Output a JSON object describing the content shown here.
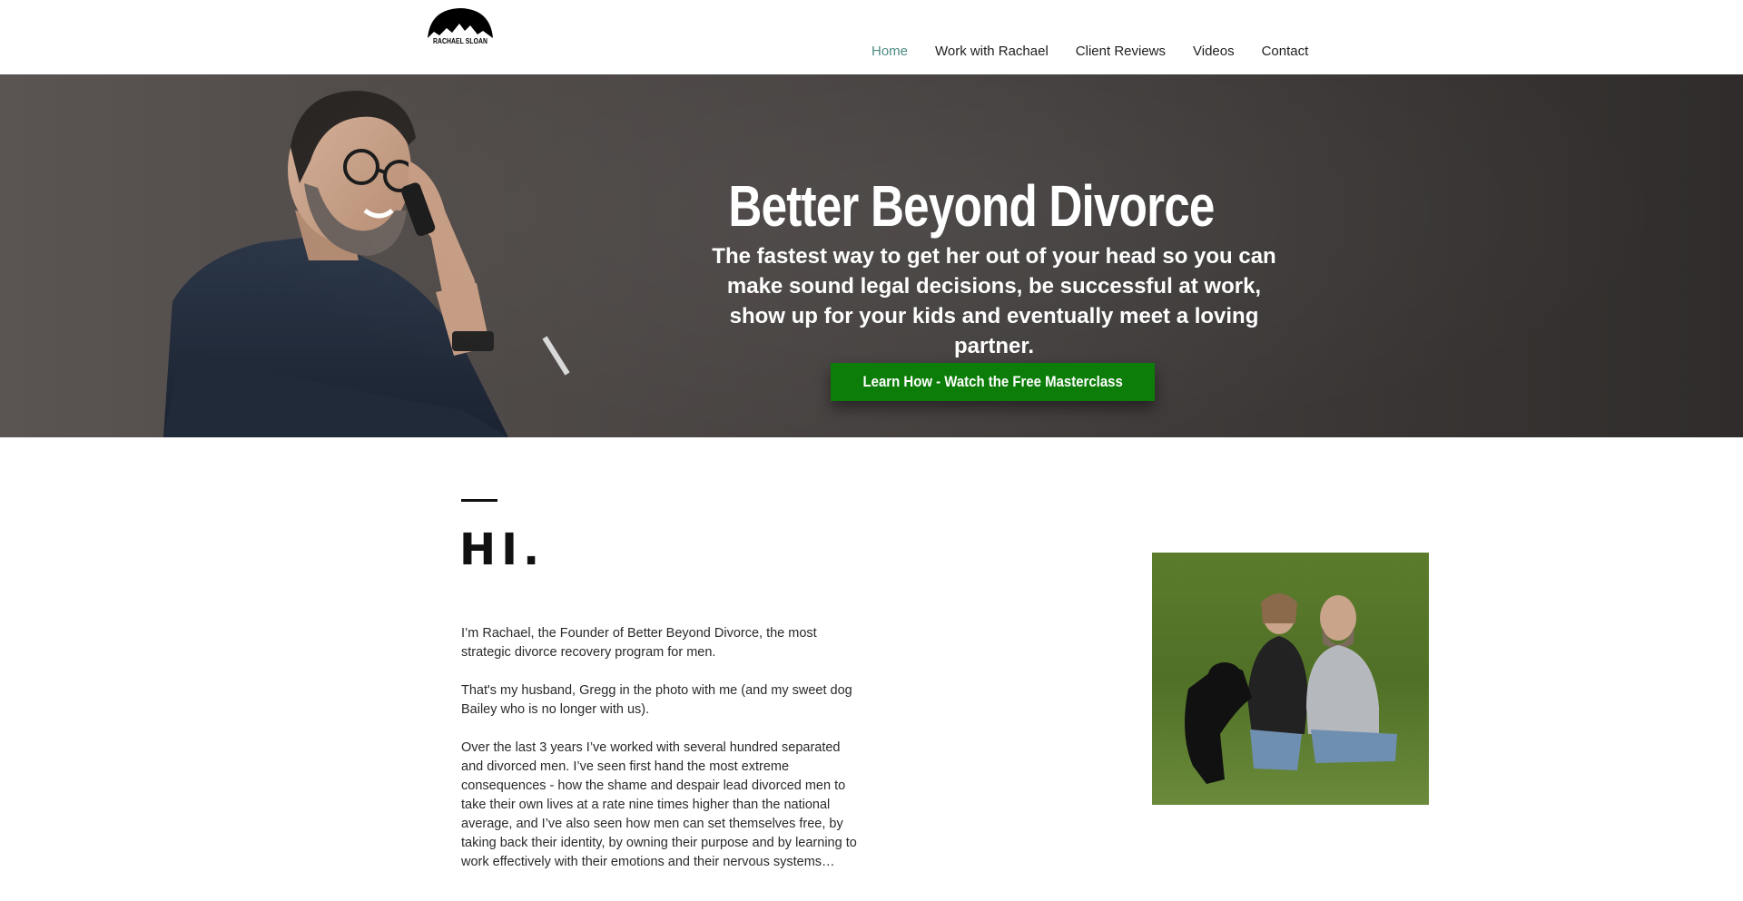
{
  "header": {
    "logo_text": "RACHAEL SLOAN",
    "nav": [
      {
        "label": "Home",
        "active": true
      },
      {
        "label": "Work with Rachael"
      },
      {
        "label": "Client Reviews"
      },
      {
        "label": "Videos"
      },
      {
        "label": "Contact"
      }
    ],
    "active_color": "#4e8a84"
  },
  "hero": {
    "title": "Better Beyond Divorce",
    "subtitle": "The fastest way to get her out of your head so you can make sound legal decisions, be successful at work, show up for your kids and eventually meet a loving partner.",
    "cta_label": "Learn How - Watch the Free Masterclass",
    "cta_color": "#0d7d0a"
  },
  "about": {
    "heading": "HI.",
    "paragraphs": [
      "I’m Rachael, the Founder of Better Beyond Divorce, the most strategic divorce recovery program for men.",
      "That's my husband, Gregg in the photo with me (and my sweet dog Bailey who is no longer with us).",
      "Over the last 3 years I’ve worked with several hundred separated and divorced men. I’ve seen first hand the most extreme consequences - how the shame and despair lead divorced men to take their own lives at a rate nine times higher than the national average,  and I’ve also seen how men can set themselves free, by taking back their identity, by owning their purpose and by learning to work effectively with their emotions and their nervous systems…"
    ]
  }
}
